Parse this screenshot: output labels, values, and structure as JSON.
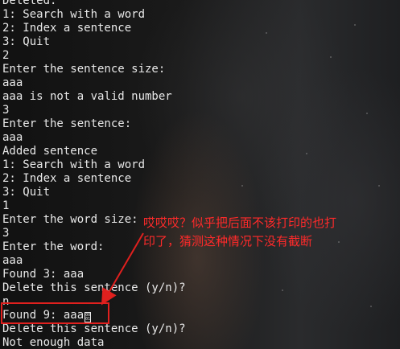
{
  "terminal": {
    "lines": [
      "Deleted.",
      "1: Search with a word",
      "2: Index a sentence",
      "3: Quit",
      "2",
      "Enter the sentence size:",
      "aaa",
      "aaa is not a valid number",
      "3",
      "Enter the sentence:",
      "aaa",
      "Added sentence",
      "1: Search with a word",
      "2: Index a sentence",
      "3: Quit",
      "1",
      "Enter the word size:",
      "3",
      "Enter the word:",
      "aaa",
      "Found 3: aaa",
      "Delete this sentence (y/n)?",
      "n",
      "Found 9: aaa",
      "Delete this sentence (y/n)?",
      "Not enough data"
    ],
    "unknown_glyph": "0001"
  },
  "annotation": {
    "text": "哎哎哎？似乎把后面不该打印的也打\n印了，猜测这种情况下没有截断",
    "color": "#ff2a2a"
  },
  "highlight": {
    "color": "#e0201e"
  }
}
